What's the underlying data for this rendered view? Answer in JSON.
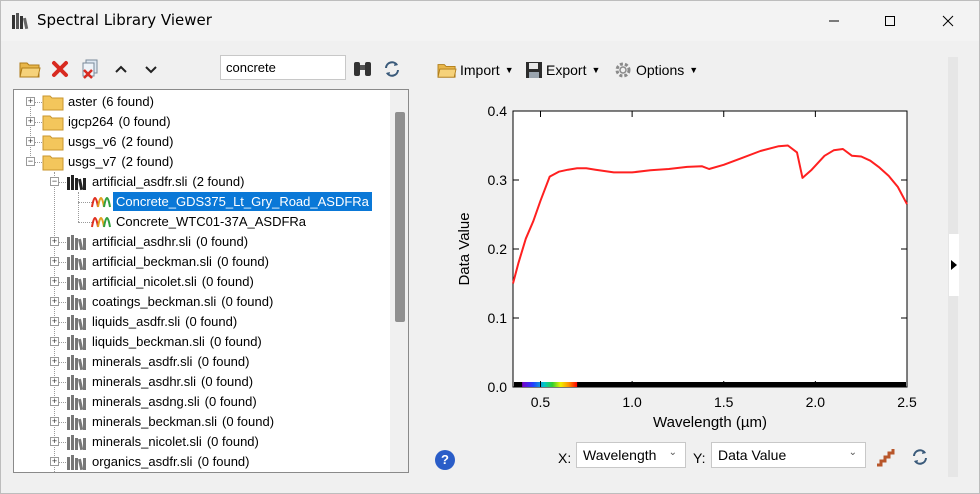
{
  "window": {
    "title": "Spectral Library Viewer"
  },
  "search": {
    "value": "concrete"
  },
  "tree": {
    "items": [
      {
        "label": "aster",
        "count": "(6 found)"
      },
      {
        "label": "igcp264",
        "count": "(0 found)"
      },
      {
        "label": "usgs_v6",
        "count": "(2 found)"
      },
      {
        "label": "usgs_v7",
        "count": "(2 found)"
      },
      {
        "label": "artificial_asdfr.sli",
        "count": "(2 found)"
      },
      {
        "label": "Concrete_GDS375_Lt_Gry_Road_ASDFRa",
        "count": ""
      },
      {
        "label": "Concrete_WTC01-37A_ASDFRa",
        "count": ""
      },
      {
        "label": "artificial_asdhr.sli",
        "count": "(0 found)"
      },
      {
        "label": "artificial_beckman.sli",
        "count": "(0 found)"
      },
      {
        "label": "artificial_nicolet.sli",
        "count": "(0 found)"
      },
      {
        "label": "coatings_beckman.sli",
        "count": "(0 found)"
      },
      {
        "label": "liquids_asdfr.sli",
        "count": "(0 found)"
      },
      {
        "label": "liquids_beckman.sli",
        "count": "(0 found)"
      },
      {
        "label": "minerals_asdfr.sli",
        "count": "(0 found)"
      },
      {
        "label": "minerals_asdhr.sli",
        "count": "(0 found)"
      },
      {
        "label": "minerals_asdng.sli",
        "count": "(0 found)"
      },
      {
        "label": "minerals_beckman.sli",
        "count": "(0 found)"
      },
      {
        "label": "minerals_nicolet.sli",
        "count": "(0 found)"
      },
      {
        "label": "organics_asdfr.sli",
        "count": "(0 found)"
      }
    ]
  },
  "toolbar": {
    "import_label": "Import",
    "export_label": "Export",
    "options_label": "Options"
  },
  "controls": {
    "x_label": "X:",
    "x_value": "Wavelength",
    "y_label": "Y:",
    "y_value": "Data Value"
  },
  "colors": {
    "selection": "#0a78d7",
    "curve": "#ff2020"
  },
  "chart_data": {
    "type": "line",
    "xlabel": "Wavelength (µm)",
    "ylabel": "Data Value",
    "xlim": [
      0.35,
      2.5
    ],
    "ylim": [
      0.0,
      0.4
    ],
    "xticks": [
      "0.5",
      "1.0",
      "1.5",
      "2.0",
      "2.5"
    ],
    "yticks": [
      "0.0",
      "0.1",
      "0.2",
      "0.3",
      "0.4"
    ],
    "series": [
      {
        "x": [
          0.35,
          0.38,
          0.42,
          0.46,
          0.5,
          0.55,
          0.6,
          0.65,
          0.7,
          0.75,
          0.8,
          0.9,
          1.0,
          1.1,
          1.2,
          1.3,
          1.38,
          1.42,
          1.5,
          1.6,
          1.7,
          1.8,
          1.85,
          1.9,
          1.93,
          1.98,
          2.05,
          2.1,
          2.15,
          2.2,
          2.25,
          2.3,
          2.35,
          2.4,
          2.45,
          2.5
        ],
        "y": [
          0.15,
          0.18,
          0.215,
          0.24,
          0.27,
          0.305,
          0.312,
          0.315,
          0.317,
          0.317,
          0.315,
          0.311,
          0.311,
          0.314,
          0.316,
          0.319,
          0.32,
          0.316,
          0.322,
          0.332,
          0.342,
          0.349,
          0.35,
          0.34,
          0.303,
          0.315,
          0.335,
          0.343,
          0.345,
          0.335,
          0.334,
          0.328,
          0.318,
          0.306,
          0.29,
          0.265
        ]
      }
    ]
  }
}
